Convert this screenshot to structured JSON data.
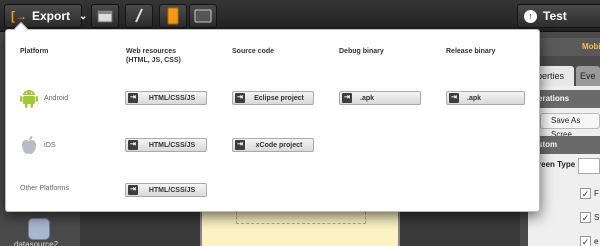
{
  "toolbar": {
    "export_label": "Export",
    "test_label": "Test"
  },
  "export_popup": {
    "columns": {
      "platform": "Platform",
      "web_resources": "Web resources\n(HTML, JS, CSS)",
      "source_code": "Source code",
      "debug_binary": "Debug binary",
      "release_binary": "Release binary"
    },
    "rows": {
      "android": {
        "name": "Android",
        "web": "HTML/CSS/JS",
        "source": "Eclipse project",
        "debug": ".apk",
        "release": ".apk"
      },
      "ios": {
        "name": "iOS",
        "web": "HTML/CSS/JS",
        "source": "xCode project"
      },
      "other": {
        "name": "Other Platforms",
        "web": "HTML/CSS/JS"
      }
    }
  },
  "right_panel": {
    "mobile_tab": "Mobi",
    "properties_tab": "operties",
    "events_tab": "Eve",
    "operations_header": "erations",
    "save_as_screen": "Save As Scree",
    "custom_header": "stom",
    "screen_type": "reen Type",
    "cb1": "F",
    "cb2": "S",
    "cb3": "e"
  },
  "left": {
    "datasource_label": "datasource2"
  },
  "colors": {
    "accent": "#f39a1e",
    "android_green": "#a4c639"
  }
}
